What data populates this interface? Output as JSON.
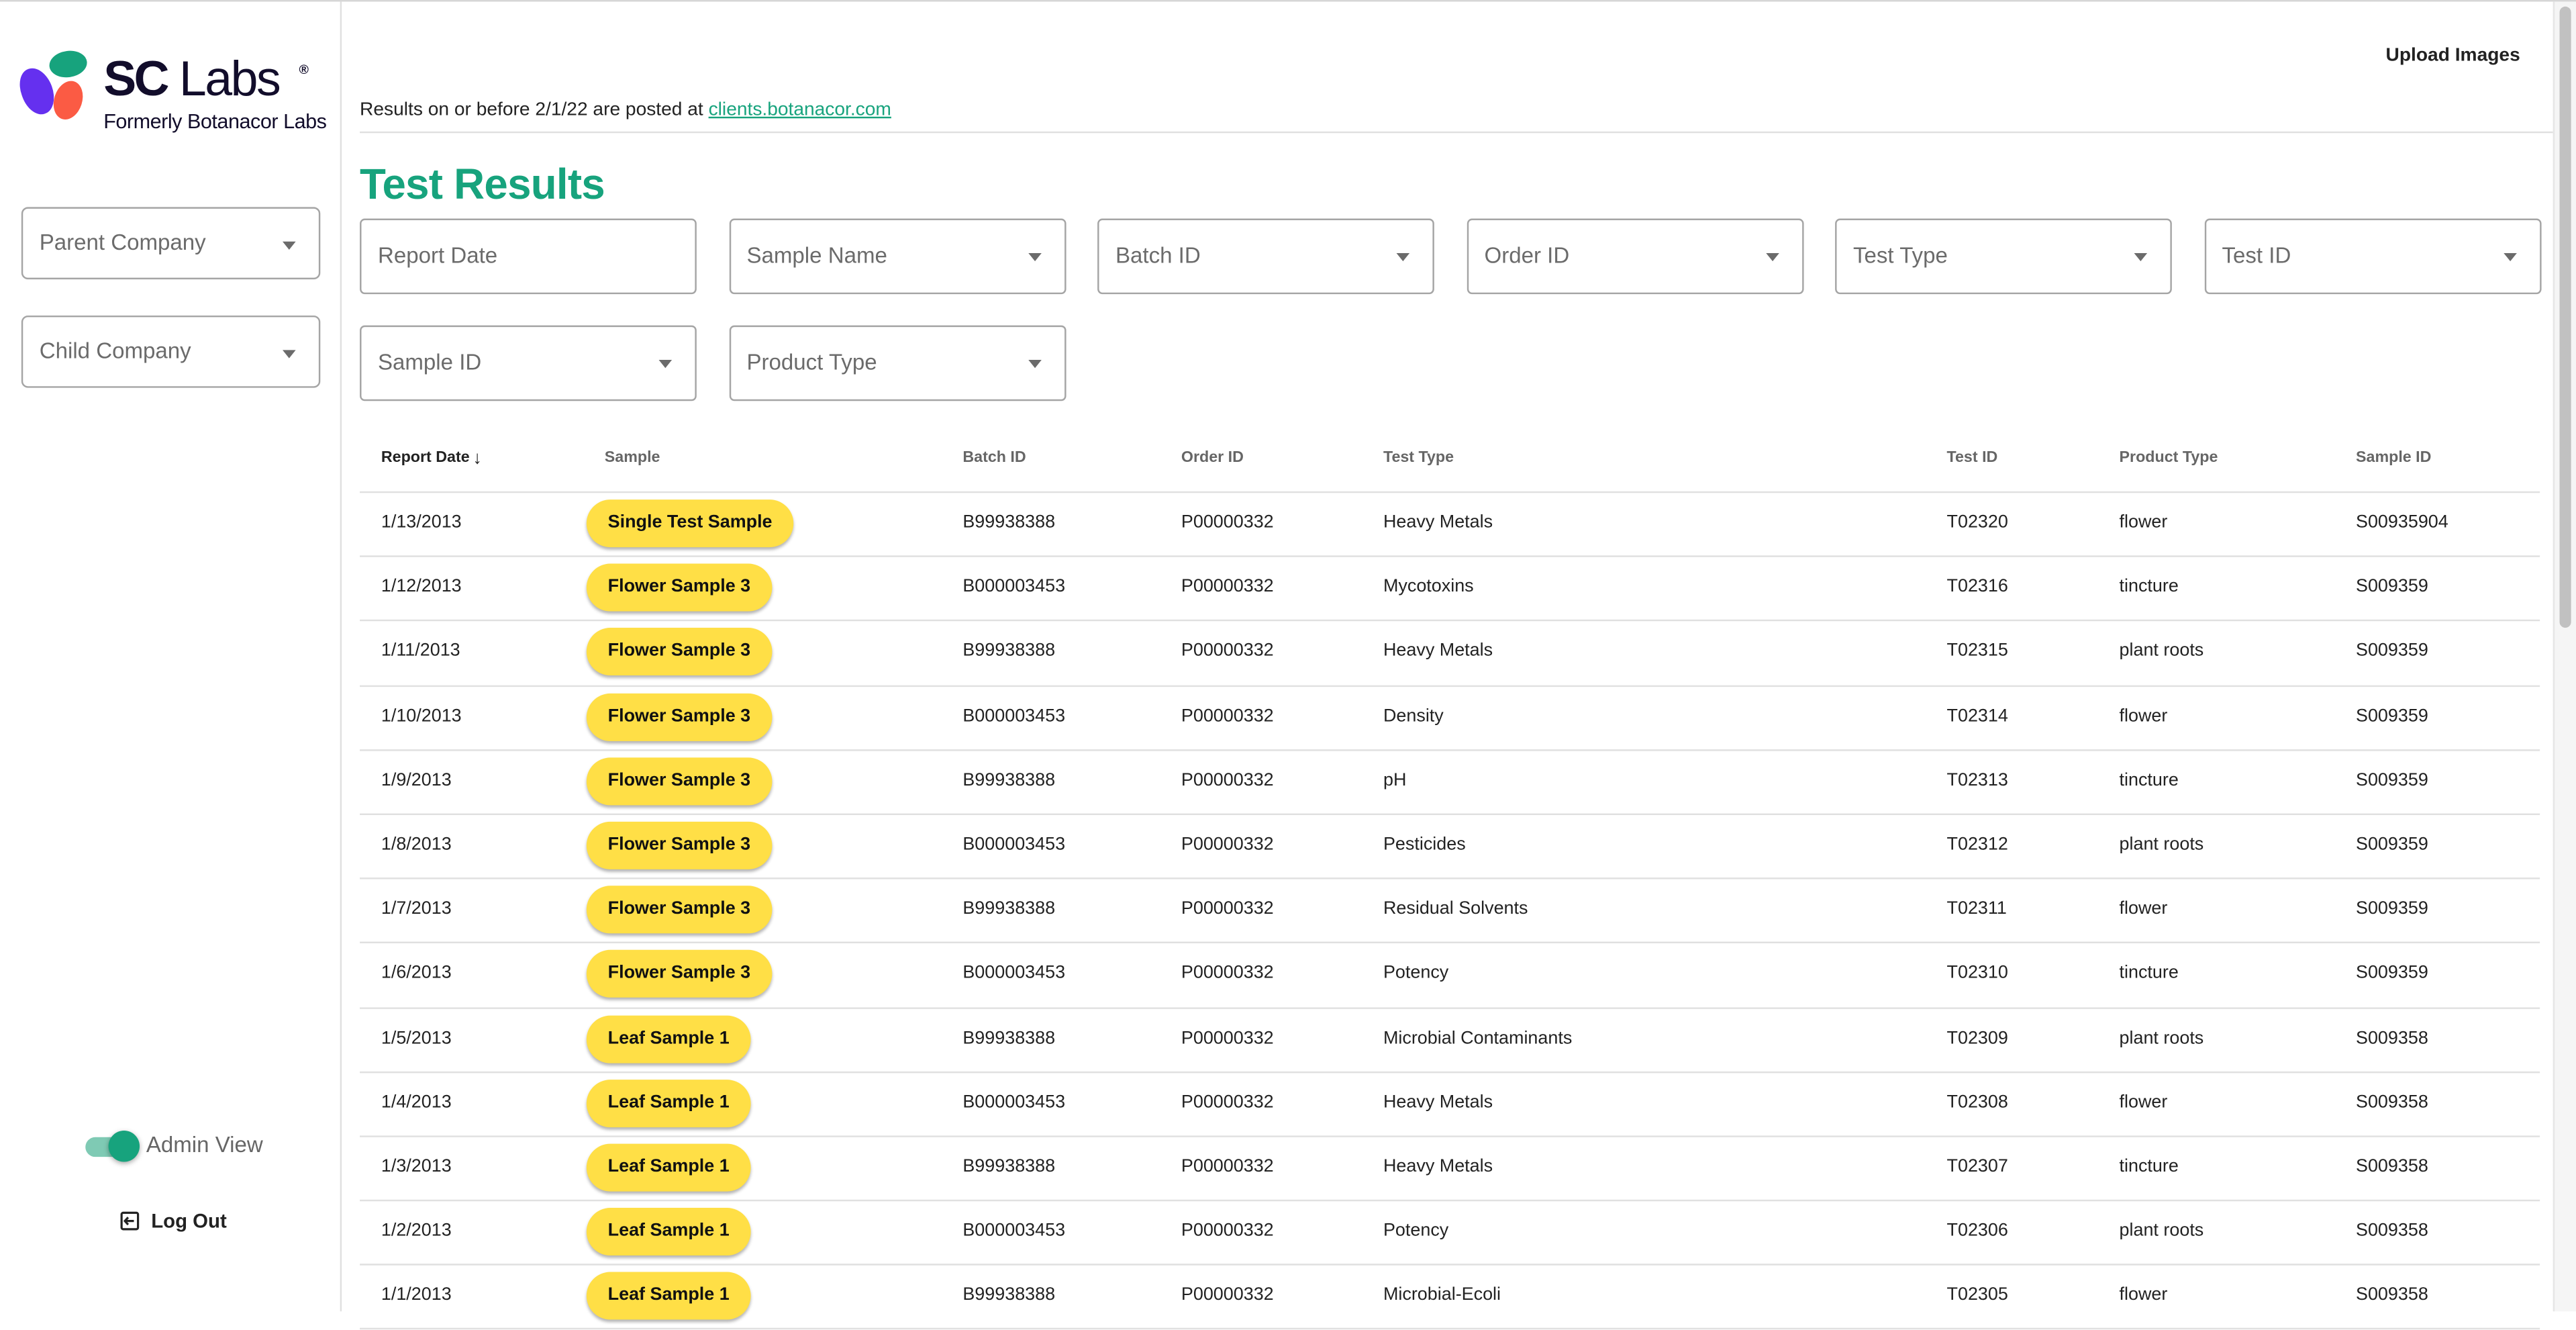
{
  "brand": {
    "name_bold": "SC",
    "name_light": "Labs",
    "registered_mark": "®",
    "subtitle": "Formerly Botanacor Labs",
    "colors": {
      "purple": "#6530ef",
      "green": "#17a37d",
      "red": "#fb5b44",
      "navy": "#120d2b"
    }
  },
  "sidebar": {
    "parent_company": {
      "label": "Parent Company",
      "icon": "caret-down-icon"
    },
    "child_company": {
      "label": "Child Company",
      "icon": "caret-down-icon"
    },
    "admin_view": {
      "label": "Admin View",
      "checked": true
    },
    "logout": {
      "label": "Log Out",
      "icon": "logout-icon"
    }
  },
  "header": {
    "upload_label": "Upload Images",
    "notice_prefix": "Results on or before 2/1/22 are posted at",
    "notice_link": "clients.botanacor.com",
    "title": "Test Results",
    "accent_color": "#17a37d"
  },
  "filters": [
    {
      "label": "Report Date",
      "has_dropdown": false
    },
    {
      "label": "Sample Name",
      "has_dropdown": true
    },
    {
      "label": "Batch ID",
      "has_dropdown": true
    },
    {
      "label": "Order ID",
      "has_dropdown": true
    },
    {
      "label": "Test Type",
      "has_dropdown": true
    },
    {
      "label": "Test ID",
      "has_dropdown": true
    },
    {
      "label": "Sample ID",
      "has_dropdown": true
    },
    {
      "label": "Product Type",
      "has_dropdown": true
    }
  ],
  "table": {
    "columns": [
      "Report Date",
      "Sample",
      "Batch ID",
      "Order ID",
      "Test Type",
      "Test ID",
      "Product Type",
      "Sample ID"
    ],
    "sort": {
      "column": "Report Date",
      "direction": "descending",
      "icon": "arrow-down-icon"
    },
    "pill_color": "#ffdf46",
    "rows": [
      {
        "date": "1/13/2013",
        "sample": "Single Test Sample",
        "batch": "B99938388",
        "order": "P00000332",
        "test_type": "Heavy Metals",
        "test_id": "T02320",
        "product": "flower",
        "sample_id": "S00935904"
      },
      {
        "date": "1/12/2013",
        "sample": "Flower Sample 3",
        "batch": "B000003453",
        "order": "P00000332",
        "test_type": "Mycotoxins",
        "test_id": "T02316",
        "product": "tincture",
        "sample_id": "S009359"
      },
      {
        "date": "1/11/2013",
        "sample": "Flower Sample 3",
        "batch": "B99938388",
        "order": "P00000332",
        "test_type": "Heavy Metals",
        "test_id": "T02315",
        "product": "plant roots",
        "sample_id": "S009359"
      },
      {
        "date": "1/10/2013",
        "sample": "Flower Sample 3",
        "batch": "B000003453",
        "order": "P00000332",
        "test_type": "Density",
        "test_id": "T02314",
        "product": "flower",
        "sample_id": "S009359"
      },
      {
        "date": "1/9/2013",
        "sample": "Flower Sample 3",
        "batch": "B99938388",
        "order": "P00000332",
        "test_type": "pH",
        "test_id": "T02313",
        "product": "tincture",
        "sample_id": "S009359"
      },
      {
        "date": "1/8/2013",
        "sample": "Flower Sample 3",
        "batch": "B000003453",
        "order": "P00000332",
        "test_type": "Pesticides",
        "test_id": "T02312",
        "product": "plant roots",
        "sample_id": "S009359"
      },
      {
        "date": "1/7/2013",
        "sample": "Flower Sample 3",
        "batch": "B99938388",
        "order": "P00000332",
        "test_type": "Residual Solvents",
        "test_id": "T02311",
        "product": "flower",
        "sample_id": "S009359"
      },
      {
        "date": "1/6/2013",
        "sample": "Flower Sample 3",
        "batch": "B000003453",
        "order": "P00000332",
        "test_type": "Potency",
        "test_id": "T02310",
        "product": "tincture",
        "sample_id": "S009359"
      },
      {
        "date": "1/5/2013",
        "sample": "Leaf Sample 1",
        "batch": "B99938388",
        "order": "P00000332",
        "test_type": "Microbial Contaminants",
        "test_id": "T02309",
        "product": "plant roots",
        "sample_id": "S009358"
      },
      {
        "date": "1/4/2013",
        "sample": "Leaf Sample 1",
        "batch": "B000003453",
        "order": "P00000332",
        "test_type": "Heavy Metals",
        "test_id": "T02308",
        "product": "flower",
        "sample_id": "S009358"
      },
      {
        "date": "1/3/2013",
        "sample": "Leaf Sample 1",
        "batch": "B99938388",
        "order": "P00000332",
        "test_type": "Heavy Metals",
        "test_id": "T02307",
        "product": "tincture",
        "sample_id": "S009358"
      },
      {
        "date": "1/2/2013",
        "sample": "Leaf Sample 1",
        "batch": "B000003453",
        "order": "P00000332",
        "test_type": "Potency",
        "test_id": "T02306",
        "product": "plant roots",
        "sample_id": "S009358"
      },
      {
        "date": "1/1/2013",
        "sample": "Leaf Sample 1",
        "batch": "B99938388",
        "order": "P00000332",
        "test_type": "Microbial-Ecoli",
        "test_id": "T02305",
        "product": "flower",
        "sample_id": "S009358"
      }
    ]
  }
}
